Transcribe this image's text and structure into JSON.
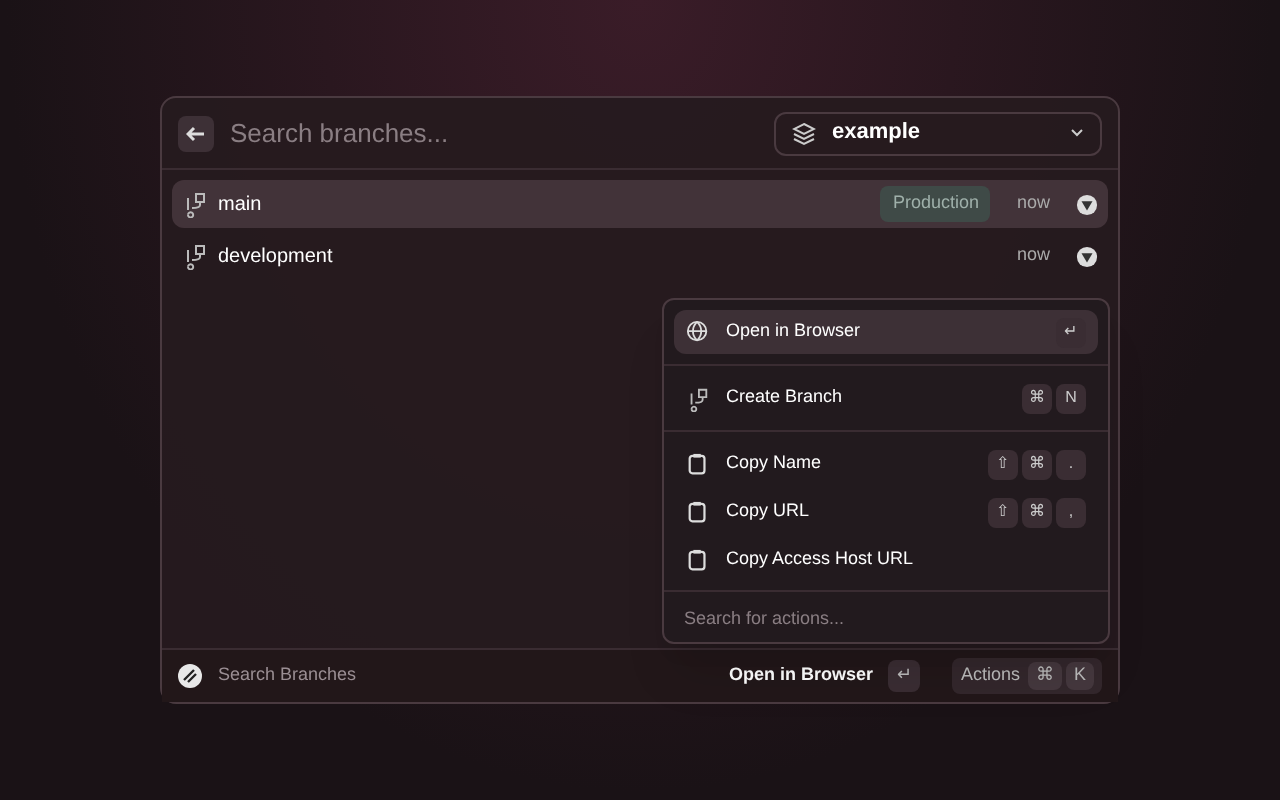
{
  "search": {
    "placeholder": "Search branches..."
  },
  "project_select": {
    "value": "example"
  },
  "branches": [
    {
      "name": "main",
      "badge": "Production",
      "time": "now",
      "selected": true
    },
    {
      "name": "development",
      "time": "now",
      "selected": false
    }
  ],
  "actions": {
    "items": [
      {
        "label": "Open in Browser",
        "kind": "globe",
        "keys": [
          "↵"
        ],
        "selected": true,
        "divider_after": true
      },
      {
        "label": "Create Branch",
        "kind": "branch",
        "keys": [
          "⌘",
          "N"
        ],
        "selected": false,
        "divider_after": true
      },
      {
        "label": "Copy Name",
        "kind": "clipboard",
        "keys": [
          "⇧",
          "⌘",
          "."
        ],
        "selected": false,
        "divider_after": false
      },
      {
        "label": "Copy URL",
        "kind": "clipboard",
        "keys": [
          "⇧",
          "⌘",
          ","
        ],
        "selected": false,
        "divider_after": false
      },
      {
        "label": "Copy Access Host URL",
        "kind": "clipboard",
        "selected": false,
        "divider_after": false
      }
    ],
    "search": {
      "placeholder": "Search for actions..."
    }
  },
  "footer": {
    "title": "Search Branches",
    "primary_action": "Open in Browser",
    "primary_key": "↵",
    "actions_label": "Actions",
    "actions_keys": [
      "⌘",
      "K"
    ]
  }
}
